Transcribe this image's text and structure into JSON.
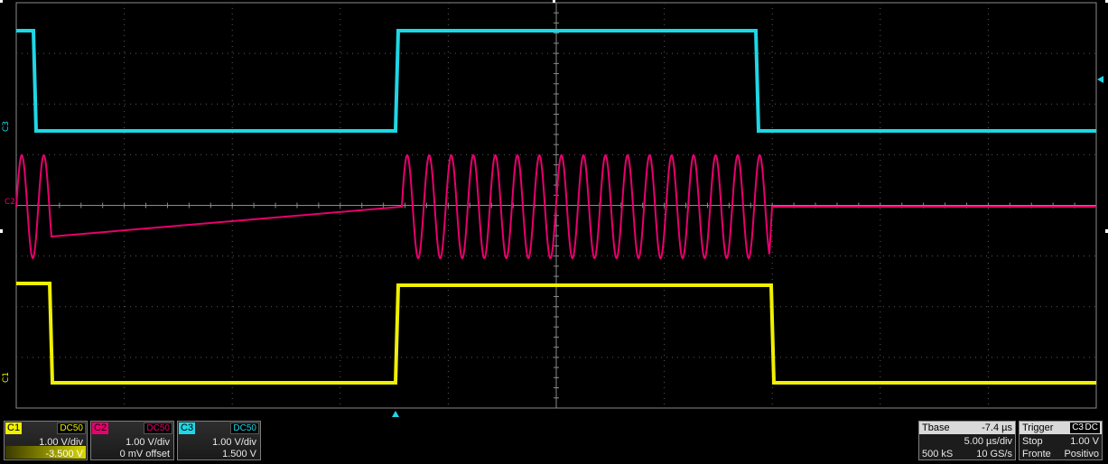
{
  "colors": {
    "c1": "#f0f000",
    "c2": "#e8006e",
    "c3": "#1ed7e6",
    "grid": "#5a5a5a",
    "background": "#000000"
  },
  "trace_labels": {
    "c3": "C3",
    "c2": "C2",
    "c1": "C1"
  },
  "channels": [
    {
      "tag": "C1",
      "coupling": "DC50",
      "scale": "1.00 V/div",
      "offset": "-3.500 V"
    },
    {
      "tag": "C2",
      "coupling": "DC50",
      "scale": "1.00 V/div",
      "offset": "0 mV offset"
    },
    {
      "tag": "C3",
      "coupling": "DC50",
      "scale": "1.00 V/div",
      "offset": "1.500 V"
    }
  ],
  "timebase": {
    "title": "Tbase",
    "delay": "-7.4 µs",
    "scale": "5.00 µs/div",
    "samples": "500 kS",
    "rate": "10 GS/s"
  },
  "trigger": {
    "title": "Trigger",
    "source": "C3",
    "coupling": "DC",
    "mode": "Stop",
    "level": "1.00 V",
    "edge_word": "Fronte",
    "slope": "Positivo"
  },
  "markers": {
    "trigger_position_icon": "triangle-up-icon",
    "trigger_level_icon": "triangle-left-icon"
  }
}
